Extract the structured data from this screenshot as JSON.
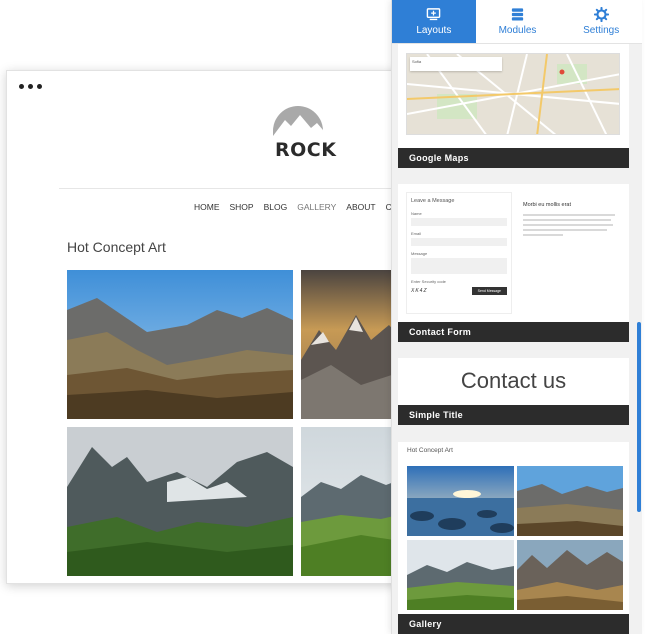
{
  "site": {
    "logo_text": "ROCK",
    "nav": [
      "HOME",
      "SHOP",
      "BLOG",
      "GALLERY",
      "ABOUT",
      "CONTACT"
    ],
    "active_nav": "GALLERY",
    "page_title": "Hot Concept Art"
  },
  "panel": {
    "tabs": [
      {
        "label": "Layouts",
        "icon": "layouts-icon",
        "active": true
      },
      {
        "label": "Modules",
        "icon": "modules-icon",
        "active": false
      },
      {
        "label": "Settings",
        "icon": "settings-icon",
        "active": false
      }
    ],
    "accent_color": "#2f7fd6",
    "label_bar_color": "#2c2c2c",
    "cards": {
      "map": {
        "label": "Google Maps",
        "city": "Sofia"
      },
      "contact": {
        "label": "Contact Form",
        "form_title": "Leave a Message",
        "name_label": "Name",
        "email_label": "Email",
        "message_label": "Message",
        "security_label": "Enter Security code",
        "captcha": "XK4Z",
        "send_label": "Send Message",
        "side_title": "Morbi eu mollis erat"
      },
      "title": {
        "label": "Simple Title",
        "heading": "Contact us"
      },
      "gallery": {
        "label": "Gallery",
        "title": "Hot Concept Art"
      }
    }
  }
}
